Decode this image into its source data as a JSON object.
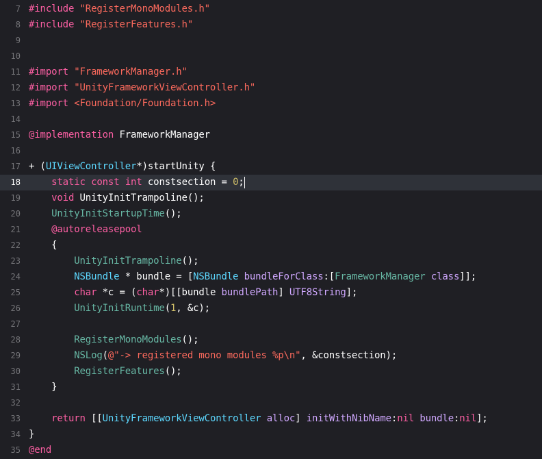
{
  "editor": {
    "lines": [
      {
        "num": "7",
        "indent": "",
        "tokens": [
          {
            "t": "#include",
            "c": "k"
          },
          {
            "t": " ",
            "c": "tx"
          },
          {
            "t": "\"RegisterMonoModules.h\"",
            "c": "s"
          }
        ]
      },
      {
        "num": "8",
        "indent": "",
        "tokens": [
          {
            "t": "#include",
            "c": "k"
          },
          {
            "t": " ",
            "c": "tx"
          },
          {
            "t": "\"RegisterFeatures.h\"",
            "c": "s"
          }
        ]
      },
      {
        "num": "9",
        "indent": "",
        "tokens": []
      },
      {
        "num": "10",
        "indent": "",
        "tokens": []
      },
      {
        "num": "11",
        "indent": "",
        "tokens": [
          {
            "t": "#import",
            "c": "k"
          },
          {
            "t": " ",
            "c": "tx"
          },
          {
            "t": "\"FrameworkManager.h\"",
            "c": "s"
          }
        ]
      },
      {
        "num": "12",
        "indent": "",
        "tokens": [
          {
            "t": "#import",
            "c": "k"
          },
          {
            "t": " ",
            "c": "tx"
          },
          {
            "t": "\"UnityFrameworkViewController.h\"",
            "c": "s"
          }
        ]
      },
      {
        "num": "13",
        "indent": "",
        "tokens": [
          {
            "t": "#import",
            "c": "k"
          },
          {
            "t": " ",
            "c": "tx"
          },
          {
            "t": "<Foundation/Foundation.h>",
            "c": "s"
          }
        ]
      },
      {
        "num": "14",
        "indent": "",
        "tokens": []
      },
      {
        "num": "15",
        "indent": "",
        "tokens": [
          {
            "t": "@implementation",
            "c": "k"
          },
          {
            "t": " FrameworkManager",
            "c": "tx"
          }
        ]
      },
      {
        "num": "16",
        "indent": "",
        "tokens": []
      },
      {
        "num": "17",
        "indent": "",
        "tokens": [
          {
            "t": "+ (",
            "c": "tx"
          },
          {
            "t": "UIViewController",
            "c": "ty"
          },
          {
            "t": "*)startUnity {",
            "c": "tx"
          }
        ]
      },
      {
        "num": "18",
        "indent": "    ",
        "current": true,
        "caret": true,
        "tokens": [
          {
            "t": "static",
            "c": "k"
          },
          {
            "t": " ",
            "c": "tx"
          },
          {
            "t": "const",
            "c": "k"
          },
          {
            "t": " ",
            "c": "tx"
          },
          {
            "t": "int",
            "c": "k"
          },
          {
            "t": " constsection = ",
            "c": "tx"
          },
          {
            "t": "0",
            "c": "nm"
          },
          {
            "t": ";",
            "c": "tx"
          }
        ]
      },
      {
        "num": "19",
        "indent": "    ",
        "tokens": [
          {
            "t": "void",
            "c": "k"
          },
          {
            "t": " UnityInitTrampoline();",
            "c": "tx"
          }
        ]
      },
      {
        "num": "20",
        "indent": "    ",
        "tokens": [
          {
            "t": "UnityInitStartupTime",
            "c": "fn"
          },
          {
            "t": "();",
            "c": "tx"
          }
        ]
      },
      {
        "num": "21",
        "indent": "    ",
        "tokens": [
          {
            "t": "@autoreleasepool",
            "c": "k"
          }
        ]
      },
      {
        "num": "22",
        "indent": "    ",
        "tokens": [
          {
            "t": "{",
            "c": "tx"
          }
        ]
      },
      {
        "num": "23",
        "indent": "        ",
        "tokens": [
          {
            "t": "UnityInitTrampoline",
            "c": "fn"
          },
          {
            "t": "();",
            "c": "tx"
          }
        ]
      },
      {
        "num": "24",
        "indent": "        ",
        "tokens": [
          {
            "t": "NSBundle",
            "c": "ty"
          },
          {
            "t": " * bundle = [",
            "c": "tx"
          },
          {
            "t": "NSBundle",
            "c": "ty"
          },
          {
            "t": " ",
            "c": "tx"
          },
          {
            "t": "bundleForClass",
            "c": "sy"
          },
          {
            "t": ":[",
            "c": "tx"
          },
          {
            "t": "FrameworkManager",
            "c": "fn"
          },
          {
            "t": " ",
            "c": "tx"
          },
          {
            "t": "class",
            "c": "sy"
          },
          {
            "t": "]];",
            "c": "tx"
          }
        ]
      },
      {
        "num": "25",
        "indent": "        ",
        "tokens": [
          {
            "t": "char",
            "c": "k"
          },
          {
            "t": " *c = (",
            "c": "tx"
          },
          {
            "t": "char",
            "c": "k"
          },
          {
            "t": "*)[[bundle ",
            "c": "tx"
          },
          {
            "t": "bundlePath",
            "c": "sy"
          },
          {
            "t": "] ",
            "c": "tx"
          },
          {
            "t": "UTF8String",
            "c": "sy"
          },
          {
            "t": "];",
            "c": "tx"
          }
        ]
      },
      {
        "num": "26",
        "indent": "        ",
        "tokens": [
          {
            "t": "UnityInitRuntime",
            "c": "fn"
          },
          {
            "t": "(",
            "c": "tx"
          },
          {
            "t": "1",
            "c": "nm"
          },
          {
            "t": ", &c);",
            "c": "tx"
          }
        ]
      },
      {
        "num": "27",
        "indent": "",
        "tokens": []
      },
      {
        "num": "28",
        "indent": "        ",
        "tokens": [
          {
            "t": "RegisterMonoModules",
            "c": "fn"
          },
          {
            "t": "();",
            "c": "tx"
          }
        ]
      },
      {
        "num": "29",
        "indent": "        ",
        "tokens": [
          {
            "t": "NSLog",
            "c": "fn"
          },
          {
            "t": "(",
            "c": "tx"
          },
          {
            "t": "@\"-> registered mono modules %p\\n\"",
            "c": "s"
          },
          {
            "t": ", &constsection);",
            "c": "tx"
          }
        ]
      },
      {
        "num": "30",
        "indent": "        ",
        "tokens": [
          {
            "t": "RegisterFeatures",
            "c": "fn"
          },
          {
            "t": "();",
            "c": "tx"
          }
        ]
      },
      {
        "num": "31",
        "indent": "    ",
        "tokens": [
          {
            "t": "}",
            "c": "tx"
          }
        ]
      },
      {
        "num": "32",
        "indent": "",
        "tokens": []
      },
      {
        "num": "33",
        "indent": "    ",
        "tokens": [
          {
            "t": "return",
            "c": "k"
          },
          {
            "t": " [[",
            "c": "tx"
          },
          {
            "t": "UnityFrameworkViewController",
            "c": "ty"
          },
          {
            "t": " ",
            "c": "tx"
          },
          {
            "t": "alloc",
            "c": "sy"
          },
          {
            "t": "] ",
            "c": "tx"
          },
          {
            "t": "initWithNibName",
            "c": "sy"
          },
          {
            "t": ":",
            "c": "tx"
          },
          {
            "t": "nil",
            "c": "k"
          },
          {
            "t": " ",
            "c": "tx"
          },
          {
            "t": "bundle",
            "c": "sy"
          },
          {
            "t": ":",
            "c": "tx"
          },
          {
            "t": "nil",
            "c": "k"
          },
          {
            "t": "];",
            "c": "tx"
          }
        ]
      },
      {
        "num": "34",
        "indent": "",
        "tokens": [
          {
            "t": "}",
            "c": "tx"
          }
        ]
      },
      {
        "num": "35",
        "indent": "",
        "tokens": [
          {
            "t": "@end",
            "c": "k"
          }
        ]
      }
    ]
  },
  "theme": {
    "background": "#1f1f24",
    "current_line": "#2f3239",
    "gutter_text": "#747478",
    "keyword": "#fc5fa3",
    "string": "#fc6a5d",
    "project_function": "#67b7a4",
    "type": "#5dd8ff",
    "system_method": "#d0a8ff",
    "number": "#d0bf69",
    "plain": "#ffffff"
  }
}
